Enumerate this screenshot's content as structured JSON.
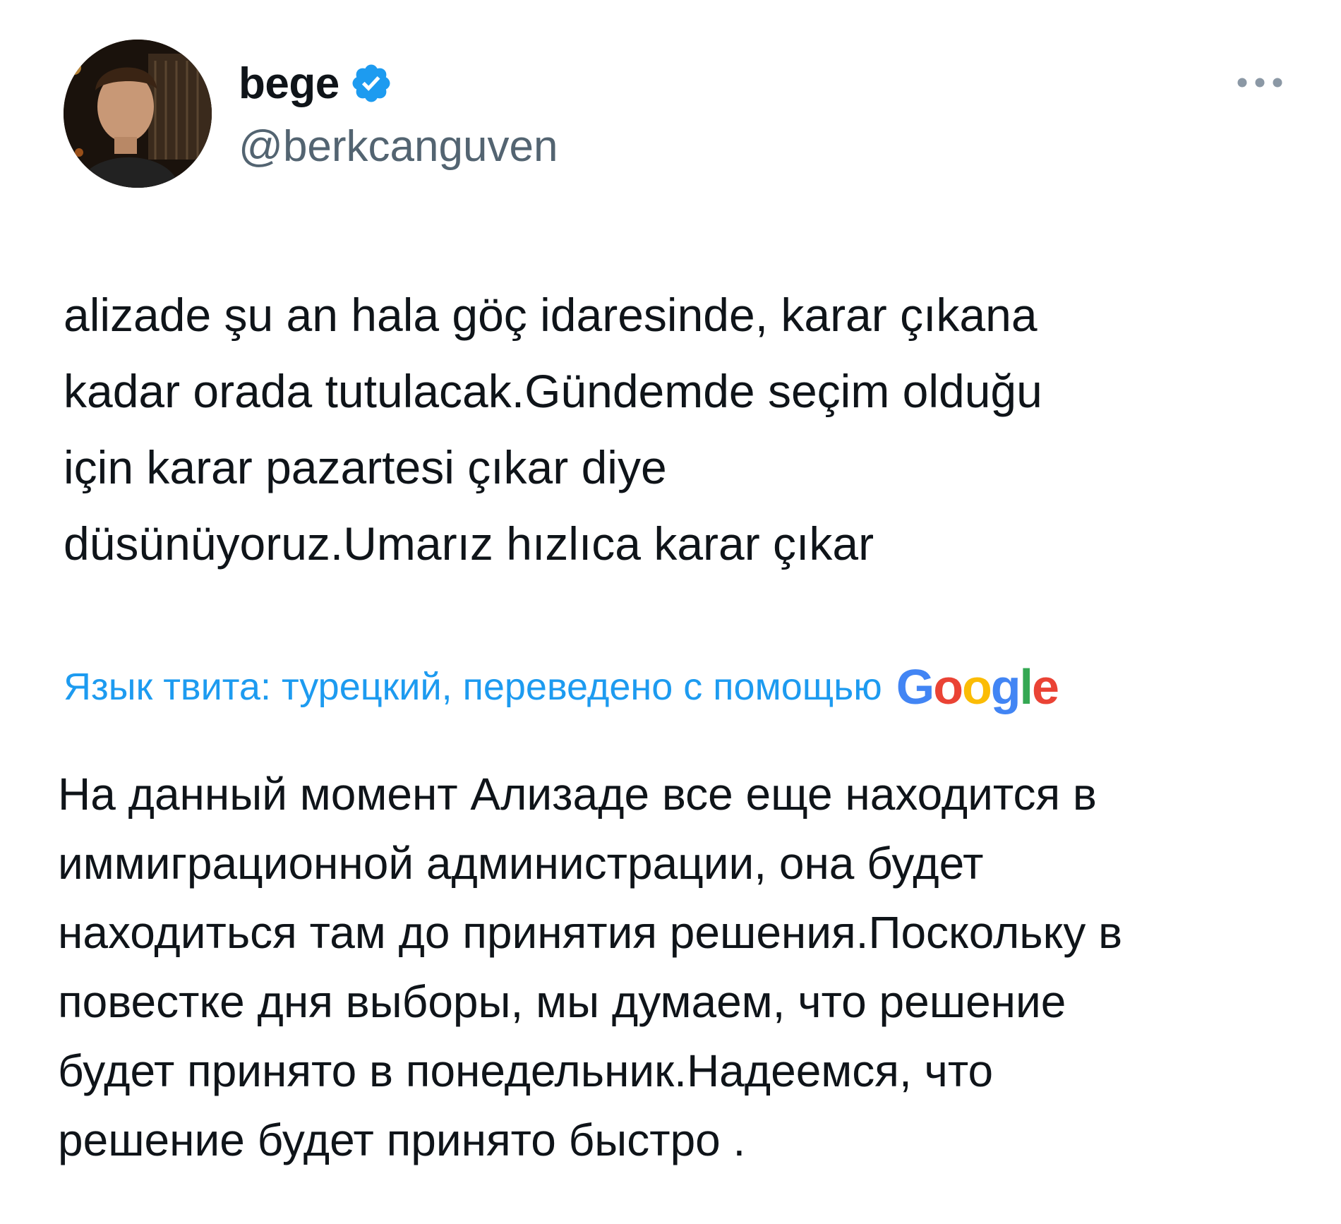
{
  "author": {
    "display_name": "bege",
    "handle": "@berkcanguven",
    "verified_icon": "verified-badge-icon",
    "avatar_icon": "profile-photo"
  },
  "actions": {
    "more_icon": "more-horizontal-icon"
  },
  "tweet": {
    "text": "alizade şu an hala göç idaresinde, karar çıkana\nkadar orada tutulacak.Gündemde seçim olduğu\niçin karar pazartesi çıkar diye\ndüsünüyoruz.Umarız hızlıca karar çıkar"
  },
  "translation": {
    "label": "Язык твита: турецкий, переведено с помощью",
    "provider": "Google",
    "text": "На данный момент Ализаде все еще находится в\nиммиграционной администрации, она будет\nнаходиться там до принятия решения.Поскольку в\nповестке дня выборы, мы думаем, что решение\nбудет принято в понедельник.Надеемся, что\nрешение будет принято быстро ."
  },
  "colors": {
    "accent": "#1d9bf0",
    "text_primary": "#0f1419",
    "text_secondary": "#536471",
    "google_blue": "#4285f4",
    "google_red": "#ea4335",
    "google_yellow": "#fbbc05",
    "google_green": "#34a853"
  }
}
